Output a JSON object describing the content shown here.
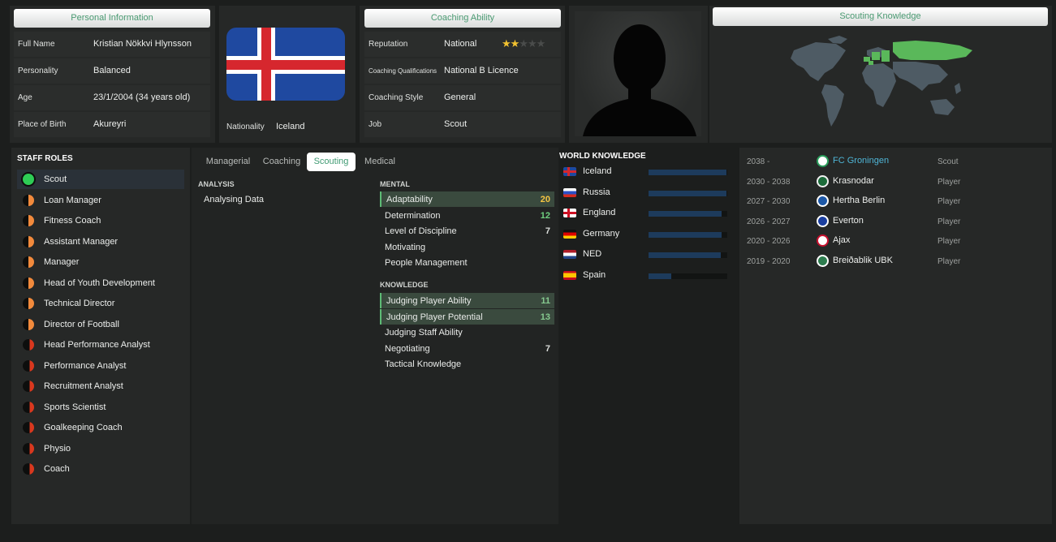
{
  "personal": {
    "header": "Personal Information",
    "rows": [
      {
        "label": "Full Name",
        "value": "Kristian Nökkvi Hlynsson"
      },
      {
        "label": "Personality",
        "value": "Balanced"
      },
      {
        "label": "Age",
        "value": "23/1/2004 (34 years old)"
      },
      {
        "label": "Place of Birth",
        "value": "Akureyri"
      }
    ]
  },
  "nationality": {
    "label": "Nationality",
    "value": "Iceland"
  },
  "coaching": {
    "header": "Coaching Ability",
    "rows": [
      {
        "label": "Reputation",
        "value": "National"
      },
      {
        "label": "Coaching Qualifications",
        "value": "National B Licence"
      },
      {
        "label": "Coaching Style",
        "value": "General"
      },
      {
        "label": "Job",
        "value": "Scout"
      }
    ],
    "reputation_stars": 2,
    "reputation_stars_max": 5
  },
  "scouting_knowledge": {
    "header": "Scouting Knowledge"
  },
  "staff_roles": {
    "title": "STAFF ROLES",
    "items": [
      {
        "label": "Scout",
        "level": "full"
      },
      {
        "label": "Loan Manager",
        "level": "half"
      },
      {
        "label": "Fitness Coach",
        "level": "half"
      },
      {
        "label": "Assistant Manager",
        "level": "half"
      },
      {
        "label": "Manager",
        "level": "half"
      },
      {
        "label": "Head of Youth Development",
        "level": "half"
      },
      {
        "label": "Technical Director",
        "level": "half"
      },
      {
        "label": "Director of Football",
        "level": "half"
      },
      {
        "label": "Head Performance Analyst",
        "level": "low"
      },
      {
        "label": "Performance Analyst",
        "level": "low"
      },
      {
        "label": "Recruitment Analyst",
        "level": "low"
      },
      {
        "label": "Sports Scientist",
        "level": "low"
      },
      {
        "label": "Goalkeeping Coach",
        "level": "low"
      },
      {
        "label": "Physio",
        "level": "low"
      },
      {
        "label": "Coach",
        "level": "low"
      }
    ]
  },
  "tabs": [
    "Managerial",
    "Coaching",
    "Scouting",
    "Medical"
  ],
  "active_tab": "Scouting",
  "analysis": {
    "title": "ANALYSIS",
    "items": [
      "Analysing Data"
    ]
  },
  "mental": {
    "title": "MENTAL",
    "items": [
      {
        "label": "Adaptability",
        "value": "20",
        "highlight": true
      },
      {
        "label": "Determination",
        "value": "12",
        "highlight": false
      },
      {
        "label": "Level of Discipline",
        "value": "7",
        "highlight": false
      },
      {
        "label": "Motivating",
        "value": "",
        "highlight": false
      },
      {
        "label": "People Management",
        "value": "",
        "highlight": false
      }
    ]
  },
  "knowledge": {
    "title": "KNOWLEDGE",
    "items": [
      {
        "label": "Judging Player Ability",
        "value": "11",
        "highlight": true
      },
      {
        "label": "Judging Player Potential",
        "value": "13",
        "highlight": true
      },
      {
        "label": "Judging Staff Ability",
        "value": "",
        "highlight": false
      },
      {
        "label": "Negotiating",
        "value": "7",
        "highlight": false
      },
      {
        "label": "Tactical Knowledge",
        "value": "",
        "highlight": false
      }
    ]
  },
  "world_knowledge": {
    "title": "WORLD KNOWLEDGE",
    "items": [
      {
        "label": "Iceland",
        "level": 0.99,
        "flag": "iceland"
      },
      {
        "label": "Russia",
        "level": 0.99,
        "flag": "russia"
      },
      {
        "label": "England",
        "level": 0.93,
        "flag": "england"
      },
      {
        "label": "Germany",
        "level": 0.93,
        "flag": "germany"
      },
      {
        "label": "NED",
        "level": 0.92,
        "flag": "netherlands"
      },
      {
        "label": "Spain",
        "level": 0.29,
        "flag": "spain"
      }
    ]
  },
  "history": [
    {
      "years": "2038 -",
      "club": "FC Groningen",
      "role": "Scout",
      "current": true
    },
    {
      "years": "2030 - 2038",
      "club": "Krasnodar",
      "role": "Player",
      "current": false
    },
    {
      "years": "2027 - 2030",
      "club": "Hertha Berlin",
      "role": "Player",
      "current": false
    },
    {
      "years": "2026 - 2027",
      "club": "Everton",
      "role": "Player",
      "current": false
    },
    {
      "years": "2020 - 2026",
      "club": "Ajax",
      "role": "Player",
      "current": false
    },
    {
      "years": "2019 - 2020",
      "club": "Breiðablik UBK",
      "role": "Player",
      "current": false
    }
  ],
  "colors": {
    "accent": "#4a9a72",
    "attr_high": "#f5c542",
    "attr_good": "#6fcf7f",
    "link": "#4fb5d6"
  }
}
